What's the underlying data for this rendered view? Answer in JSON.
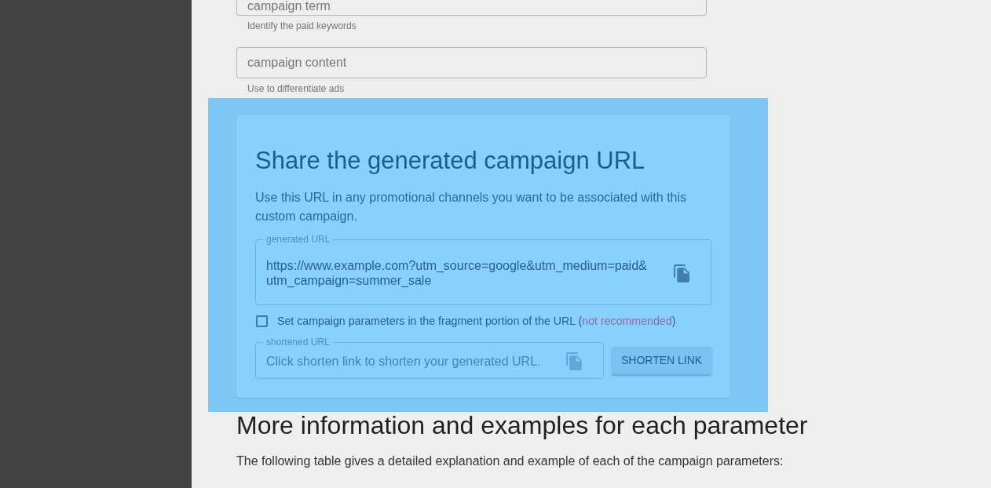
{
  "form_fields": [
    {
      "placeholder": "campaign term",
      "helper": "Identify the paid keywords"
    },
    {
      "placeholder": "campaign content",
      "helper": "Use to differentiate ads"
    }
  ],
  "share_card": {
    "title": "Share the generated campaign URL",
    "description": "Use this URL in any promotional channels you want to be associated with this custom campaign.",
    "generated_url": {
      "label": "generated URL",
      "value": "https://www.example.com?utm_source=google&utm_medium=paid&utm_campaign=summer_sale"
    },
    "fragment_option": {
      "text_before": "Set campaign parameters in the fragment portion of the URL (",
      "link_text": "not recommended",
      "text_after": ")",
      "checked": false
    },
    "shortened_url": {
      "label": "shortened URL",
      "placeholder": "Click shorten link to shorten your generated URL."
    },
    "shorten_button": "SHORTEN LINK"
  },
  "info_section": {
    "heading": "More information and examples for each parameter",
    "text": "The following table gives a detailed explanation and example of each of the campaign parameters:"
  }
}
